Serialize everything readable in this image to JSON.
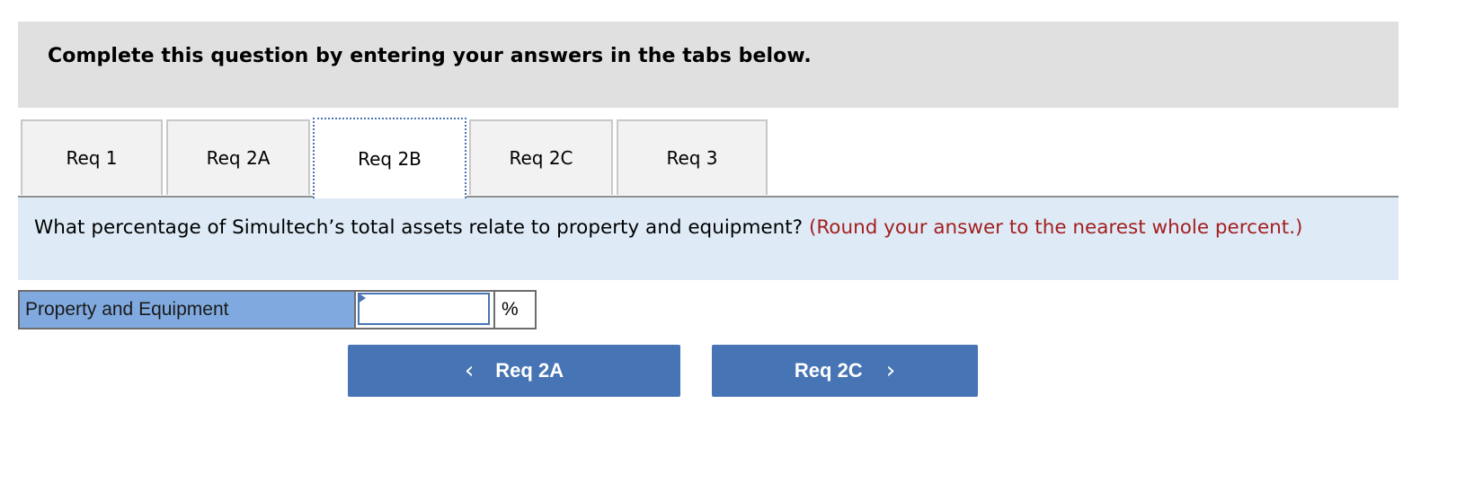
{
  "instructions": {
    "text": "Complete this question by entering your answers in the tabs below."
  },
  "tabs": [
    {
      "label": "Req 1",
      "active": false
    },
    {
      "label": "Req 2A",
      "active": false
    },
    {
      "label": "Req 2B",
      "active": true
    },
    {
      "label": "Req 2C",
      "active": false
    },
    {
      "label": "Req 3",
      "active": false
    }
  ],
  "question": {
    "text": "What percentage of Simultech’s total assets relate to property and equipment?",
    "note": "(Round your answer to the nearest whole percent.)"
  },
  "answer": {
    "label": "Property and Equipment",
    "value": "",
    "unit": "%"
  },
  "navigation": {
    "prev_label": "Req 2A",
    "prev_icon": "chevron-left-icon",
    "next_label": "Req 2C",
    "next_icon": "chevron-right-icon"
  },
  "colors": {
    "accent": "#4774b4",
    "note_red": "#a31f1f",
    "question_bg": "#deebf7",
    "label_bg": "#80aadf"
  }
}
